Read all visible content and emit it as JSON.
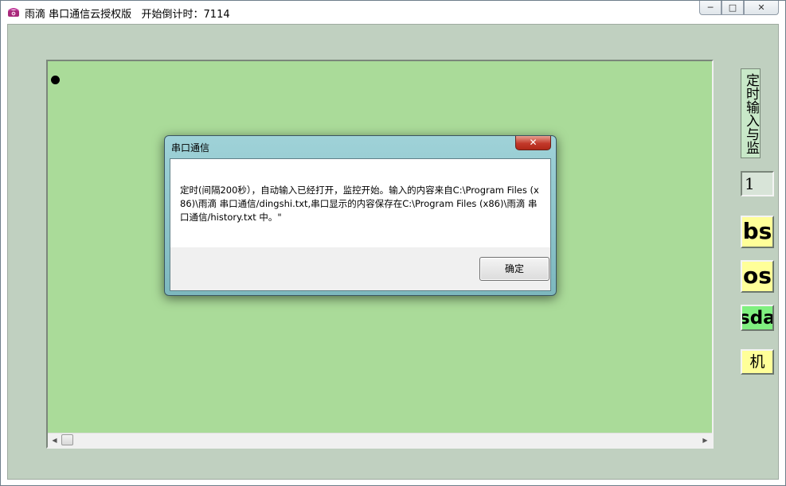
{
  "window": {
    "title": "雨滴 串口通信云授权版   开始倒计时：7114",
    "app_icon": "telephone-icon",
    "minimize_glyph": "─",
    "maximize_glyph": "□",
    "close_glyph": "✕"
  },
  "panel": {
    "scroll_left_glyph": "◀",
    "scroll_right_glyph": "▶"
  },
  "side": {
    "title": "定时输入与监控",
    "value": "1",
    "buttons": [
      "bs",
      "os",
      "sda",
      "机"
    ]
  },
  "dialog": {
    "title": "串口通信",
    "close_glyph": "✕",
    "message": "定时(间隔200秒），自动输入已经打开，监控开始。输入的内容来自C:\\Program Files (x86)\\雨滴 串口通信/dingshi.txt,串口显示的内容保存在C:\\Program Files (x86)\\雨滴 串口通信/history.txt 中。\"",
    "ok_label": "确定"
  },
  "colors": {
    "client_bg": "#c0d0c0",
    "panel_bg": "#aadb99",
    "button_yellow": "#ffff99",
    "button_green": "#80f080",
    "dialog_frame": "#8cc4ca"
  }
}
